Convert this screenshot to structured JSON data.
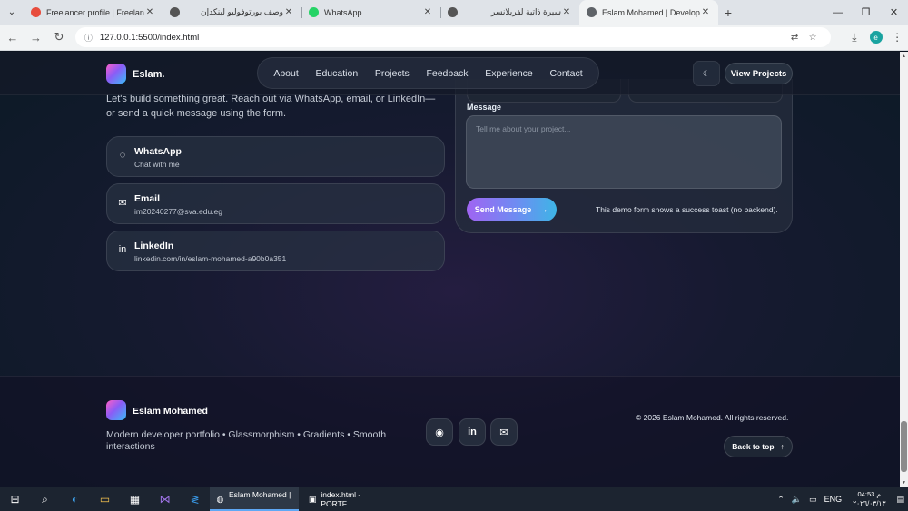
{
  "browser": {
    "tabs": [
      {
        "title": "Freelancer profile | Freelance Y",
        "rtl": false,
        "favicon": "freelancer-favicon",
        "color": "#e74c3c"
      },
      {
        "title": "وصف بورتوفوليو لينكدإن",
        "rtl": true,
        "favicon": "chatgpt-favicon",
        "color": "#555555"
      },
      {
        "title": "WhatsApp",
        "rtl": false,
        "favicon": "whatsapp-favicon",
        "color": "#25d366"
      },
      {
        "title": "سيرة ذاتية لفريلانسر",
        "rtl": true,
        "favicon": "chatgpt-favicon",
        "color": "#555555"
      },
      {
        "title": "Eslam Mohamed | Developer P",
        "rtl": false,
        "favicon": "globe-favicon",
        "color": "#5f6368",
        "active": true
      }
    ],
    "url": "127.0.0.1:5500/index.html"
  },
  "page": {
    "brand": "Eslam.",
    "nav": [
      "About",
      "Education",
      "Projects",
      "Feedback",
      "Experience",
      "Contact"
    ],
    "view_projects": "View Projects",
    "intro_lines": [
      "Let's build something great. Reach out via WhatsApp, email, or LinkedIn—",
      "or send a quick message using the form."
    ],
    "contacts": [
      {
        "title": "WhatsApp",
        "sub": "Chat with me",
        "icon": "whatsapp-icon",
        "glyph": "◌"
      },
      {
        "title": "Email",
        "sub": "im20240277@sva.edu.eg",
        "icon": "mail-icon",
        "glyph": "✉"
      },
      {
        "title": "LinkedIn",
        "sub": "linkedin.com/in/eslam-mohamed-a90b0a351",
        "icon": "linkedin-icon",
        "glyph": "in"
      }
    ],
    "form": {
      "message_label": "Message",
      "message_placeholder": "Tell me about your project...",
      "send_label": "Send Message",
      "send_arrow": "→",
      "note": "This demo form shows a success toast (no backend)."
    },
    "footer": {
      "name": "Eslam Mohamed",
      "tagline": "Modern developer portfolio • Glassmorphism • Gradients • Smooth interactions",
      "copyright": "© 2026 Eslam Mohamed. All rights reserved.",
      "back_to_top": "Back to top",
      "back_arrow": "↑",
      "social": [
        {
          "name": "github-icon",
          "glyph": "◉"
        },
        {
          "name": "linkedin-icon",
          "glyph": "in"
        },
        {
          "name": "mail-icon",
          "glyph": "✉"
        }
      ]
    }
  },
  "taskbar": {
    "apps": [
      {
        "label": "Eslam Mohamed | ...",
        "icon": "chrome-icon",
        "active": true
      },
      {
        "label": "index.html - PORTF...",
        "icon": "vscode-icon",
        "active": false
      }
    ],
    "lang": "ENG",
    "time": "04:53 م",
    "date": "٢٠٢٦/٠٣/١٣"
  }
}
